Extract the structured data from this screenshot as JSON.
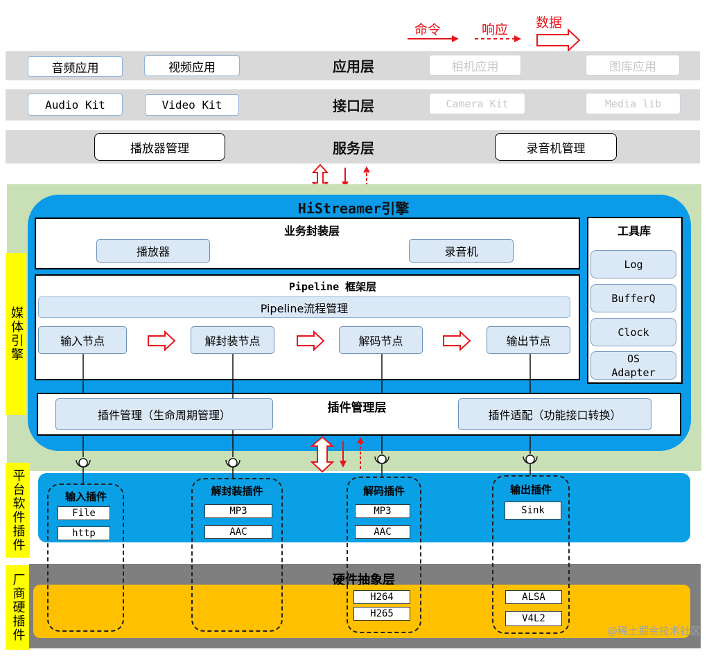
{
  "legend": {
    "command": "命令",
    "response": "响应",
    "data": "数据"
  },
  "layers": {
    "app": {
      "title": "应用层",
      "items": [
        "音频应用",
        "视频应用",
        "相机应用",
        "图库应用"
      ]
    },
    "interface": {
      "title": "接口层",
      "items": [
        "Audio Kit",
        "Video Kit",
        "Camera Kit",
        "Media lib"
      ]
    },
    "service": {
      "title": "服务层",
      "items": [
        "播放器管理",
        "录音机管理"
      ]
    }
  },
  "engine": {
    "title": "HiStreamer引擎",
    "business": {
      "title": "业务封装层",
      "items": [
        "播放器",
        "录音机"
      ]
    },
    "pipeline": {
      "title": "Pipeline 框架层",
      "manager": "Pipeline流程管理",
      "nodes": [
        "输入节点",
        "解封装节点",
        "解码节点",
        "输出节点"
      ]
    },
    "tools": {
      "title": "工具库",
      "items": [
        "Log",
        "BufferQ",
        "Clock",
        "OS Adapter"
      ]
    },
    "plugin_mgmt": {
      "title": "插件管理层",
      "left": "插件管理（生命周期管理）",
      "right": "插件适配（功能接口转换）"
    }
  },
  "side_labels": {
    "engine": "媒体引擎",
    "platform": "平台软件插件",
    "vendor": "厂商硬插件"
  },
  "plugins": [
    {
      "title": "输入插件",
      "items": [
        "File",
        "http"
      ]
    },
    {
      "title": "解封装插件",
      "items": [
        "MP3",
        "AAC"
      ]
    },
    {
      "title": "解码插件",
      "items": [
        "MP3",
        "AAC"
      ]
    },
    {
      "title": "输出插件",
      "items": [
        "Sink"
      ]
    }
  ],
  "hardware": {
    "title": "硬件抽象层",
    "decoder_items": [
      "H264",
      "H265"
    ],
    "output_items": [
      "ALSA",
      "V4L2"
    ]
  },
  "watermark": "@稀土掘金技术社区",
  "colors": {
    "engine_blue": "#0b9be8",
    "platform_blue": "#0aa0e6",
    "vendor_orange": "#ffc000",
    "side_yellow": "#ffff00",
    "green_bg": "#c9e0b6",
    "arrow_red": "#e8151b"
  }
}
